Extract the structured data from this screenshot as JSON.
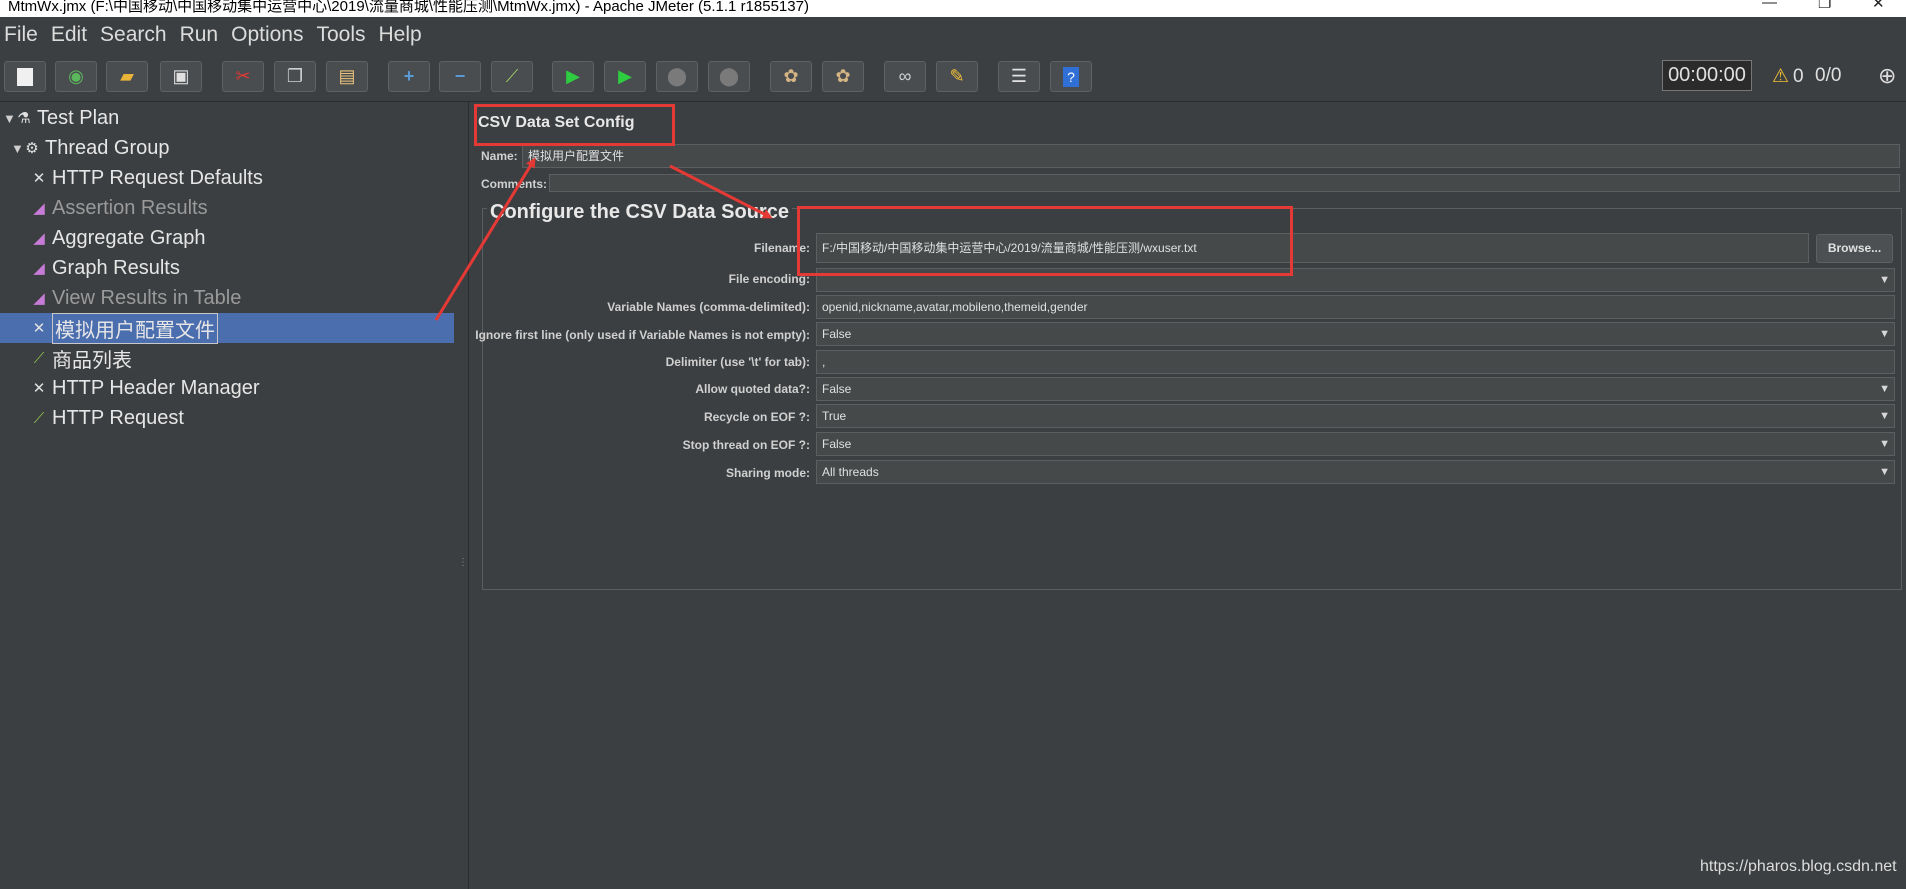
{
  "window": {
    "title": "MtmWx.jmx (F:\\中国移动\\中国移动集中运营中心\\2019\\流量商城\\性能压测\\MtmWx.jmx) - Apache JMeter (5.1.1 r1855137)"
  },
  "menu": {
    "items": [
      "File",
      "Edit",
      "Search",
      "Run",
      "Options",
      "Tools",
      "Help"
    ]
  },
  "toolbar": {
    "timer": "00:00:00",
    "warning_count": "0",
    "thread_ratio": "0/0",
    "icons": [
      "new-icon",
      "templates-icon",
      "open-icon",
      "save-icon",
      "cut-icon",
      "copy-icon",
      "paste-icon",
      "expand-icon",
      "collapse-icon",
      "toggle-icon",
      "start-icon",
      "start-no-pause-icon",
      "stop-icon",
      "shutdown-icon",
      "clear-icon",
      "clear-all-icon",
      "search-icon",
      "reset-search-icon",
      "function-helper-icon",
      "help-icon"
    ]
  },
  "tree": {
    "items": [
      {
        "label": "Test Plan",
        "icon": "flask-icon",
        "level": 0,
        "expander": true
      },
      {
        "label": "Thread Group",
        "icon": "gear-icon",
        "level": 1,
        "expander": true
      },
      {
        "label": "HTTP Request Defaults",
        "icon": "wrench-icon",
        "level": 2
      },
      {
        "label": "Assertion Results",
        "icon": "graph-icon",
        "level": 2,
        "disabled": true
      },
      {
        "label": "Aggregate Graph",
        "icon": "graph-icon",
        "level": 2
      },
      {
        "label": "Graph Results",
        "icon": "graph-icon",
        "level": 2
      },
      {
        "label": "View Results in Table",
        "icon": "graph-icon",
        "level": 2,
        "disabled": true
      },
      {
        "label": "模拟用户配置文件",
        "icon": "wrench-icon",
        "level": 2,
        "selected": true
      },
      {
        "label": "商品列表",
        "icon": "pipette-icon",
        "level": 2
      },
      {
        "label": "HTTP Header Manager",
        "icon": "wrench-icon",
        "level": 2
      },
      {
        "label": "HTTP Request",
        "icon": "pipette-icon",
        "level": 2
      }
    ]
  },
  "panel": {
    "title": "CSV Data Set Config",
    "name_label": "Name:",
    "name_value": "模拟用户配置文件",
    "comments_label": "Comments:",
    "comments_value": "",
    "section_title": "Configure the CSV Data Source",
    "browse_label": "Browse...",
    "fields": [
      {
        "label": "Filename:",
        "value": "F:/中国移动/中国移动集中运营中心/2019/流量商城/性能压测/wxuser.txt",
        "type": "text"
      },
      {
        "label": "File encoding:",
        "value": "",
        "type": "combo"
      },
      {
        "label": "Variable Names (comma-delimited):",
        "value": "openid,nickname,avatar,mobileno,themeid,gender",
        "type": "text"
      },
      {
        "label": "Ignore first line (only used if Variable Names is not empty):",
        "value": "False",
        "type": "combo"
      },
      {
        "label": "Delimiter (use '\\t' for tab):",
        "value": ",",
        "type": "text"
      },
      {
        "label": "Allow quoted data?:",
        "value": "False",
        "type": "combo"
      },
      {
        "label": "Recycle on EOF ?:",
        "value": "True",
        "type": "combo"
      },
      {
        "label": "Stop thread on EOF ?:",
        "value": "False",
        "type": "combo"
      },
      {
        "label": "Sharing mode:",
        "value": "All threads",
        "type": "combo"
      }
    ]
  },
  "watermark": "https://pharos.blog.csdn.net",
  "colors": {
    "background": "#3c3f41",
    "selection": "#4b6eaf",
    "annotation": "#e53935"
  }
}
